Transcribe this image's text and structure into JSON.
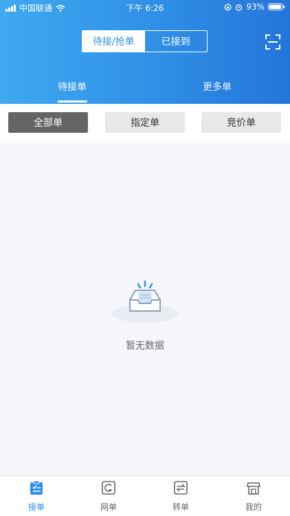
{
  "status": {
    "carrier": "中国联通",
    "time": "下午 6:26",
    "battery": "93%",
    "battery_level": 0.93
  },
  "header": {
    "segments": [
      "待接/抢单",
      "已接到"
    ],
    "active_segment": "待接/抢单",
    "subtabs": [
      "待接单",
      "更多单"
    ],
    "active_subtab": "待接单"
  },
  "filters": [
    "全部单",
    "指定单",
    "竞价单"
  ],
  "active_filter": "全部单",
  "empty": {
    "text": "暂无数据",
    "icon": "empty-inbox-icon"
  },
  "tabbar": [
    {
      "label": "接单",
      "icon": "clipboard-list-icon"
    },
    {
      "label": "网单",
      "icon": "web-order-icon"
    },
    {
      "label": "转单",
      "icon": "transfer-icon"
    },
    {
      "label": "我的",
      "icon": "store-icon"
    }
  ],
  "colors": {
    "header_start": "#3fa9f0",
    "header_end": "#2475d9",
    "accent": "#2e8ff0",
    "filter_active": "#656565"
  }
}
